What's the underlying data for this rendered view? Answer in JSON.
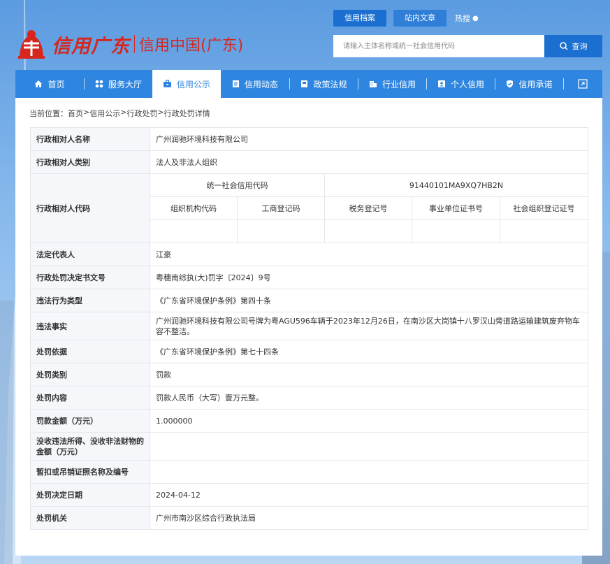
{
  "logo": {
    "brand": "信用广东",
    "sub": "信用中国(广东)"
  },
  "top_tabs": [
    {
      "label": "信用档案"
    },
    {
      "label": "站内文章"
    }
  ],
  "top_link": {
    "label": "热搜"
  },
  "search": {
    "placeholder": "请输入主体名称或统一社会信用代码",
    "button": "查询"
  },
  "nav": [
    {
      "label": "首页",
      "icon": "home-icon"
    },
    {
      "label": "服务大厅",
      "icon": "grid-icon"
    },
    {
      "label": "信用公示",
      "icon": "briefcase-icon"
    },
    {
      "label": "信用动态",
      "icon": "document-icon"
    },
    {
      "label": "政策法规",
      "icon": "book-icon"
    },
    {
      "label": "行业信用",
      "icon": "building-icon"
    },
    {
      "label": "个人信用",
      "icon": "id-card-icon"
    },
    {
      "label": "信用承诺",
      "icon": "shield-icon"
    }
  ],
  "breadcrumb": [
    "当前位置：",
    "首页",
    " > ",
    "信用公示",
    " > ",
    "行政处罚",
    " > ",
    "行政处罚详情"
  ],
  "detail": {
    "party_name_label": "行政相对人名称",
    "party_name": "广州润驰环境科技有限公司",
    "party_type_label": "行政相对人类别",
    "party_type": "法人及非法人组织",
    "party_code_label": "行政相对人代码",
    "uscc_label": "统一社会信用代码",
    "uscc": "91440101MA9XQ7HB2N",
    "code_headers": [
      "组织机构代码",
      "工商登记码",
      "税务登记号",
      "事业单位证书号",
      "社会组织登记证号"
    ],
    "legal_rep_label": "法定代表人",
    "legal_rep": "江豪",
    "doc_no_label": "行政处罚决定书文号",
    "doc_no": "粤穗南综执(大)罚字〔2024〕9号",
    "violation_type_label": "违法行为类型",
    "violation_type": "《广东省环境保护条例》第四十条",
    "facts_label": "违法事实",
    "facts": "广州润驰环境科技有限公司号牌为粤AGU596车辆于2023年12月26日，在南沙区大岗镇十八罗汉山旁道路运输建筑废弃物车容不整洁。",
    "basis_label": "处罚依据",
    "basis": "《广东省环境保护条例》第七十四条",
    "penalty_type_label": "处罚类别",
    "penalty_type": "罚款",
    "penalty_content_label": "处罚内容",
    "penalty_content": "罚款人民币（大写）壹万元整。",
    "fine_label": "罚款金额（万元）",
    "fine": "1.000000",
    "confiscation_label": "没收违法所得、没收非法财物的金额（万元）",
    "confiscation": "",
    "license_label": "暂扣或吊销证照名称及编号",
    "license": "",
    "decision_date_label": "处罚决定日期",
    "decision_date": "2024-04-12",
    "authority_label": "处罚机关",
    "authority": "广州市南沙区综合行政执法局"
  }
}
